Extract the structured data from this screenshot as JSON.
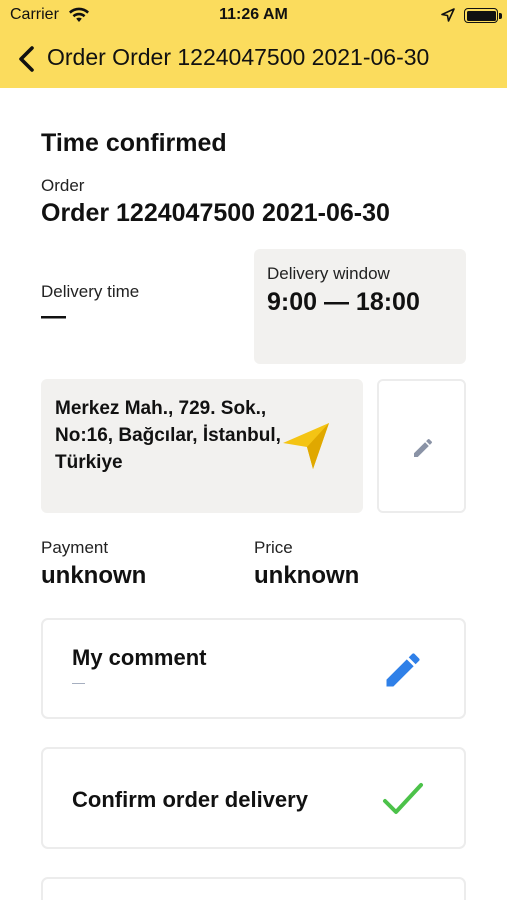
{
  "status_bar": {
    "carrier": "Carrier",
    "time": "11:26 AM"
  },
  "nav": {
    "title": "Order Order 1224047500 2021-06-30"
  },
  "status_heading": "Time confirmed",
  "order": {
    "label": "Order",
    "value": "Order 1224047500 2021-06-30"
  },
  "delivery_time": {
    "label": "Delivery time",
    "value": "—"
  },
  "delivery_window": {
    "label": "Delivery window",
    "value": "9:00 — 18:00"
  },
  "address": {
    "text": "Merkez Mah., 729. Sok., No:16, Bağcılar, İstanbul, Türkiye"
  },
  "payment": {
    "label": "Payment",
    "value": "unknown"
  },
  "price": {
    "label": "Price",
    "value": "unknown"
  },
  "comment_card": {
    "title": "My comment",
    "value": "—"
  },
  "confirm_card": {
    "title": "Confirm order delivery"
  },
  "colors": {
    "header": "#fbdc5d",
    "box": "#f2f1ef",
    "accent_blue": "#2f80e8",
    "accent_green": "#4cc24a",
    "nav_arrow": "#f4c414"
  },
  "icons": [
    "wifi-icon",
    "location-arrow-icon",
    "battery-icon",
    "back-chevron-icon",
    "navigation-arrow-icon",
    "pencil-icon",
    "checkmark-icon"
  ]
}
